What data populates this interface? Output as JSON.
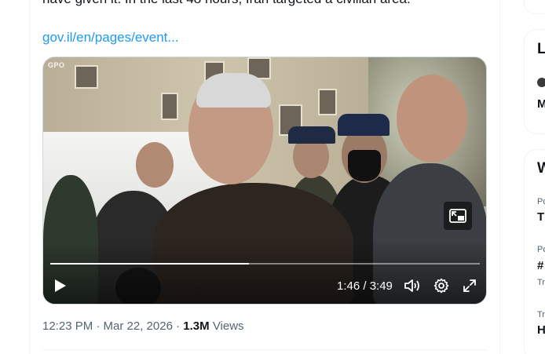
{
  "tweet": {
    "text_fragment": "have given it. In the last 48 hours, Iran targeted a civilian area.",
    "link": "gov.il/en/pages/event...",
    "timestamp": "12:23 PM · Mar 22, 2026",
    "separator": "·",
    "views_count": "1.3M",
    "views_label": "Views"
  },
  "video": {
    "watermark": "GPO",
    "time_display": "1:46 / 3:49",
    "progress_fraction": 0.463,
    "controls": {
      "play": "play-icon",
      "volume": "volume-icon",
      "settings": "gear-icon",
      "fullscreen": "fullscreen-icon",
      "pip": "picture-in-picture-icon"
    }
  },
  "sidebar": {
    "card1_partial": [
      "L",
      "M"
    ],
    "card2_partial": [
      "W",
      "Pc",
      "T",
      "Pc",
      "#",
      "Tr",
      "Tr",
      "H"
    ]
  },
  "colors": {
    "link": "#1d9bf0",
    "secondary_text": "#536471",
    "primary_text": "#0f1419"
  }
}
